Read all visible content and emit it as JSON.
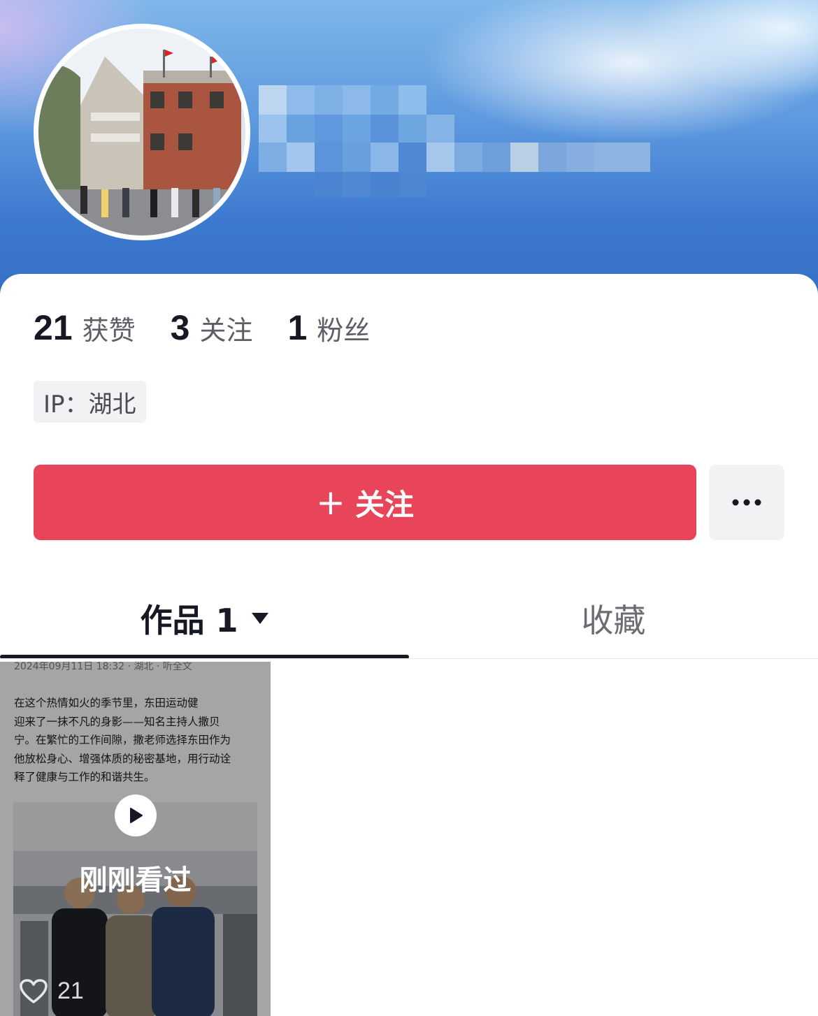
{
  "profile": {
    "stats": [
      {
        "value": "21",
        "label": "获赞"
      },
      {
        "value": "3",
        "label": "关注"
      },
      {
        "value": "1",
        "label": "粉丝"
      }
    ],
    "ip_label": "IP：湖北"
  },
  "actions": {
    "follow_label": "关注",
    "follow_plus": "+",
    "more_icon": "more-horizontal-icon"
  },
  "tabs": {
    "works_label": "作品 1",
    "favorites_label": "收藏"
  },
  "video": {
    "meta": "2024年09月11日 18:32 · 湖北 · 听全文",
    "text": "在这个热情如火的季节里，东田运动健\n迎来了一抹不凡的身影——知名主持人撒贝\n宁。在繁忙的工作间隙，撒老师选择东田作为\n他放松身心、增强体质的秘密基地，用行动诠\n释了健康与工作的和谐共生。",
    "overlay_label": "刚刚看过",
    "likes": "21",
    "play_icon": "play-icon",
    "heart_icon": "heart-icon"
  },
  "colors": {
    "follow_button": "#e8455b",
    "banner_blue": "#3c79cf",
    "text_primary": "#161823"
  }
}
